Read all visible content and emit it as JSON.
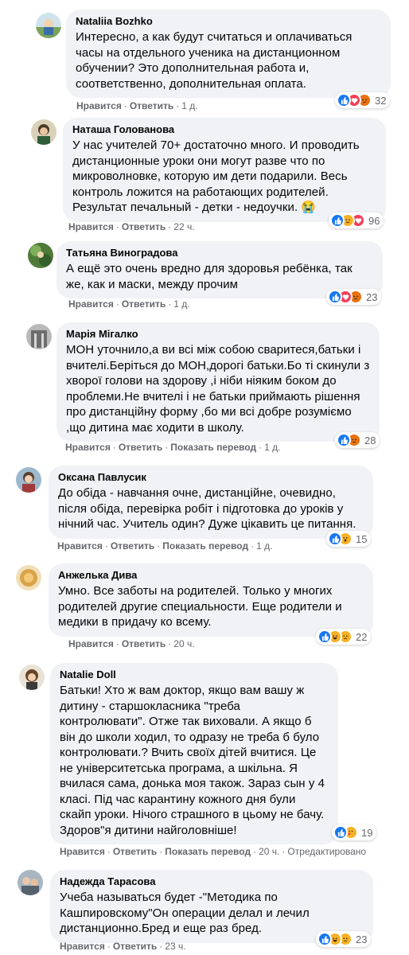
{
  "actions": {
    "like": "Нравится",
    "reply": "Ответить",
    "translate": "Показать перевод",
    "edited": "Отредактировано"
  },
  "colors": {
    "bubble": "#f0f2f5",
    "meta": "#65676b",
    "like": "#1877f2",
    "love": "#f33e58",
    "haha": "#f7b125",
    "angry": "#e9710f"
  },
  "comments": [
    {
      "author": "Nataliia Bozhko",
      "text": "Интересно, а как будут считаться и оплачиваться часы на отдельного ученика на дистанционном обучении? Это дополнительная работа и, соответственно, дополнительная оплата.",
      "time": "1 д.",
      "reactions": [
        "like-icon",
        "love-icon",
        "angry-icon"
      ],
      "count": "32"
    },
    {
      "author": "Наташа Голованова",
      "text": "У нас учителей 70+ достаточно много. И проводить дистанционные уроки они могут разве что по микроволновке, которую им дети подарили. Весь контроль ложится на работающих родителей. Результат печальный - детки - недоучки. 😭",
      "time": "22 ч.",
      "reactions": [
        "like-icon",
        "sad-icon",
        "love-icon"
      ],
      "count": "96"
    },
    {
      "author": "Татьяна Виноградова",
      "text": "А ещё это очень вредно для здоровья ребёнка, так же, как и маски, между прочим",
      "time": "1 д.",
      "reactions": [
        "like-icon",
        "love-icon",
        "angry-icon"
      ],
      "count": "23"
    },
    {
      "author": "Марія Мігалко",
      "text": "МОН уточнило,а ви всі між собою сваритеся,батьки і вчителі.Беріться до МОН,дорогі батьки.Бо ті скинули з хворої голови на здорову ,і ніби ніяким боком до проблеми.Не вчителі і не батьки приймають рішення про дистанційну форму ,бо ми всі добре розуміємо ,що дитина має ходити в школу.",
      "time": "1 д.",
      "translate": true,
      "reactions": [
        "like-icon",
        "angry-icon"
      ],
      "count": "28"
    },
    {
      "author": "Оксана Павлусик",
      "text": "До обіда - навчання очне, дистанційне, очевидно, після обіда, перевірка робіт і підготовка до уроків у нічний час. Учитель один? Дуже цікавить це питання.",
      "time": "1 д.",
      "translate": true,
      "reactions": [
        "like-icon",
        "wow-icon"
      ],
      "count": "15"
    },
    {
      "author": "Анжелька Дива",
      "text": "Умно. Все заботы на родителей. Только у многих родителей другие специальности. Еще родители и медики в придачу ко всему.",
      "time": "20 ч.",
      "reactions": [
        "like-icon",
        "haha-icon",
        "sad-icon"
      ],
      "count": "22"
    },
    {
      "author": "Natalie Doll",
      "text": "Батьки! Хто ж вам доктор, якщо вам вашу ж дитину - старшокласника \"треба контролювати\". Отже так виховали. А якщо б він до школи ходил, то одразу не треба б було контролювати.? Вчить своїх дітей вчитися. Це не університетська програма, а шкільна. Я вчилася сама, донька моя також. Зараз сын у 4 класі. Під час карантину кожного дня були скайп уроки. Нічого страшного в цьому не бачу. Здоров\"я дитини найголовніше!",
      "time": "20 ч.",
      "translate": true,
      "edited": true,
      "reactions": [
        "like-icon",
        "care-icon"
      ],
      "count": "19"
    },
    {
      "author": "Надежда Тарасова",
      "text": "Учеба называться будет -\"Методика по Кашпировскому\"Он операции делал и лечил дистанционно.Бред и еще раз бред.",
      "time": "23 ч.",
      "reactions": [
        "like-icon",
        "haha-icon",
        "sad-icon"
      ],
      "count": "23"
    }
  ]
}
